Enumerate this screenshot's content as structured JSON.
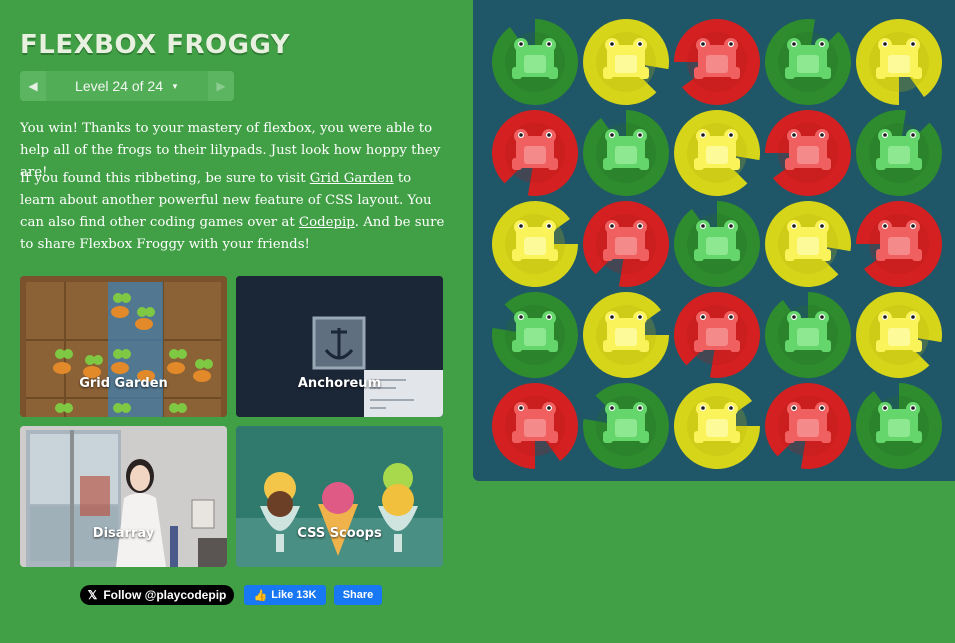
{
  "app": {
    "title": "FLEXBOX FROGGY"
  },
  "level_nav": {
    "prev_icon": "caret-left-icon",
    "label": "Level 24 of 24",
    "caret_icon": "caret-down-icon",
    "next_icon": "caret-right-icon"
  },
  "content": {
    "para1": "You win! Thanks to your mastery of flexbox, you were able to help all of the frogs to their lilypads. Just look how hoppy they are!",
    "para2_part1": "If you found this ribbeting, be sure to visit ",
    "para2_link1": "Grid Garden",
    "para2_part2": " to learn about another powerful new feature of CSS layout. You can also find other coding games over at ",
    "para2_link2": "Codepip",
    "para2_part3": ". And be sure to share Flexbox Froggy with your friends!"
  },
  "games": [
    {
      "label": "Grid Garden"
    },
    {
      "label": "Anchoreum"
    },
    {
      "label": "Disarray"
    },
    {
      "label": "CSS Scoops"
    }
  ],
  "social": {
    "twitter_label": "Follow @playcodepip",
    "like_label": "Like 13K",
    "share_label": "Share"
  },
  "colors": {
    "background": "#41a046",
    "pond": "#1f5768",
    "green_pad": "#2e8b2e",
    "yellow_pad": "#d7d51a",
    "red_pad": "#d42020",
    "green_frog": "#65d66b",
    "yellow_frog": "#fbf35a",
    "red_frog": "#f06060"
  },
  "pond_grid": [
    [
      "green",
      "yellow",
      "red",
      "green",
      "yellow"
    ],
    [
      "red",
      "green",
      "yellow",
      "red",
      "green"
    ],
    [
      "yellow",
      "red",
      "green",
      "yellow",
      "red"
    ],
    [
      "green",
      "yellow",
      "red",
      "green",
      "yellow"
    ],
    [
      "red",
      "green",
      "yellow",
      "red",
      "green"
    ]
  ]
}
